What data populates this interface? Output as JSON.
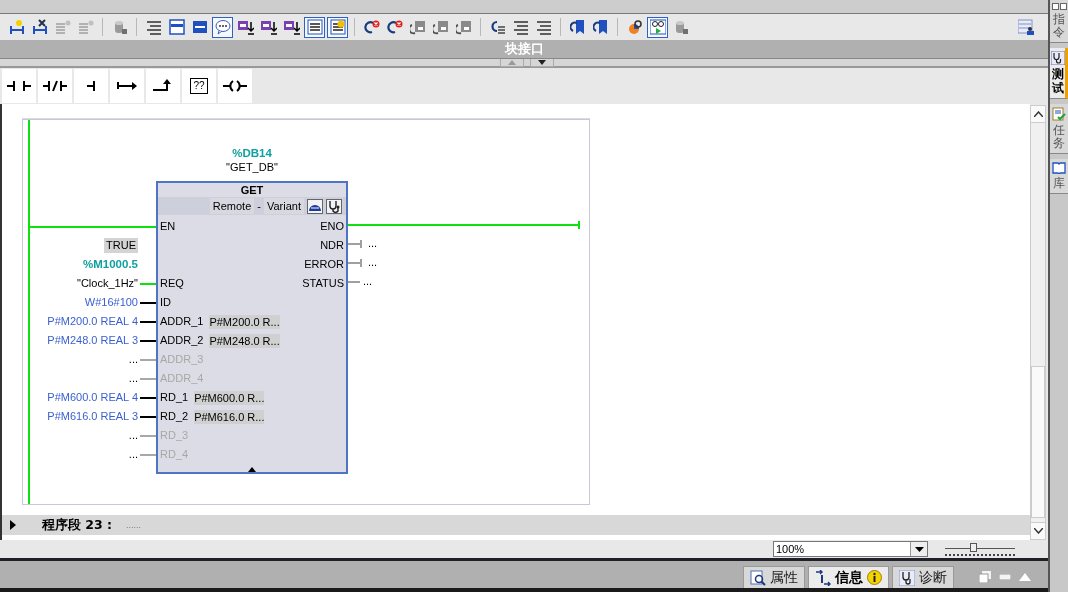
{
  "toolbar_groups": [
    {
      "buttons": [
        {
          "kind": "network-add",
          "on": false
        },
        {
          "kind": "network-delete",
          "on": false
        },
        {
          "kind": "gray-lines",
          "on": false
        },
        {
          "kind": "gray-lines",
          "on": false
        }
      ]
    },
    {
      "buttons": [
        {
          "kind": "cylinder",
          "on": false
        }
      ]
    },
    {
      "buttons": [
        {
          "kind": "lines",
          "on": false
        },
        {
          "kind": "panel",
          "on": false
        },
        {
          "kind": "panel-solid",
          "on": false
        },
        {
          "kind": "bubble",
          "on": true
        },
        {
          "kind": "tag-down",
          "on": false
        },
        {
          "kind": "tag-down",
          "on": false
        },
        {
          "kind": "tag-down",
          "on": false
        },
        {
          "kind": "list",
          "on": true
        },
        {
          "kind": "star-list",
          "on": true
        }
      ]
    },
    {
      "buttons": [
        {
          "kind": "arrow-cross",
          "on": false
        },
        {
          "kind": "arrow-cross",
          "on": false
        },
        {
          "kind": "box-arrow",
          "on": false
        },
        {
          "kind": "box-arrow",
          "on": false
        },
        {
          "kind": "box-arrow",
          "on": false
        }
      ]
    },
    {
      "buttons": [
        {
          "kind": "arrow-lines",
          "on": false
        },
        {
          "kind": "lines",
          "on": false
        },
        {
          "kind": "lines",
          "on": false
        }
      ]
    },
    {
      "buttons": [
        {
          "kind": "bookmark-arrow",
          "on": false
        },
        {
          "kind": "bookmark-arrow",
          "on": false
        }
      ]
    },
    {
      "buttons": [
        {
          "kind": "magnifier",
          "on": false
        },
        {
          "kind": "glasses",
          "on": true
        },
        {
          "kind": "cylinder",
          "on": false
        }
      ]
    }
  ],
  "interface_bar": {
    "title": "块接口"
  },
  "instructions": [
    {
      "kind": "no-contact"
    },
    {
      "kind": "nc-contact"
    },
    {
      "kind": "branch-open"
    },
    {
      "kind": "jump"
    },
    {
      "kind": "branch-close"
    },
    {
      "kind": "empty-box",
      "label": "??"
    },
    {
      "kind": "coil"
    }
  ],
  "network": {
    "powered": true,
    "block": {
      "instance_address": "%DB14",
      "instance_name": "\"GET_DB\"",
      "type": "GET",
      "variant": [
        "Remote",
        "-",
        "Variant"
      ]
    },
    "inputs": [
      {
        "pin": "EN",
        "kind": "rail",
        "powered": true,
        "disabled": false
      },
      {
        "pin": "REQ",
        "kind": "tag",
        "value": "TRUE",
        "address": "%M1000.5",
        "operand": "\"Clock_1Hz\"",
        "powered": true,
        "disabled": false
      },
      {
        "pin": "ID",
        "kind": "constant",
        "operand": "W#16#100",
        "powered": false,
        "disabled": false
      },
      {
        "pin": "ADDR_1",
        "kind": "constant",
        "operand": "P#M200.0 REAL 4",
        "hint": "P#M200.0 R...",
        "powered": false,
        "disabled": false
      },
      {
        "pin": "ADDR_2",
        "kind": "constant",
        "operand": "P#M248.0 REAL 3",
        "hint": "P#M248.0 R...",
        "powered": false,
        "disabled": false
      },
      {
        "pin": "ADDR_3",
        "kind": "empty",
        "operand": "...",
        "powered": false,
        "disabled": true
      },
      {
        "pin": "ADDR_4",
        "kind": "empty",
        "operand": "...",
        "powered": false,
        "disabled": true
      },
      {
        "pin": "RD_1",
        "kind": "constant",
        "operand": "P#M600.0 REAL 4",
        "hint": "P#M600.0 R...",
        "powered": false,
        "disabled": false
      },
      {
        "pin": "RD_2",
        "kind": "constant",
        "operand": "P#M616.0 REAL 3",
        "hint": "P#M616.0 R...",
        "powered": false,
        "disabled": false
      },
      {
        "pin": "RD_3",
        "kind": "empty",
        "operand": "...",
        "powered": false,
        "disabled": true
      },
      {
        "pin": "RD_4",
        "kind": "empty",
        "operand": "...",
        "powered": false,
        "disabled": true
      }
    ],
    "outputs": [
      {
        "pin": "ENO",
        "kind": "rail",
        "powered": true
      },
      {
        "pin": "NDR",
        "kind": "bool",
        "operand": "...",
        "powered": false
      },
      {
        "pin": "ERROR",
        "kind": "bool",
        "operand": "...",
        "powered": false
      },
      {
        "pin": "STATUS",
        "kind": "word",
        "operand": "...",
        "powered": false
      }
    ]
  },
  "next_network": {
    "title": "程序段 23 :",
    "comment": "......",
    "expanded": false
  },
  "zoom": {
    "value": "100%",
    "level": 0.4
  },
  "bottom_tabs": [
    {
      "label": "属性",
      "kind": "properties",
      "selected": false
    },
    {
      "label": "信息",
      "kind": "info",
      "selected": true
    },
    {
      "label": "诊断",
      "kind": "diagnostics",
      "selected": false
    }
  ],
  "side_tabs": [
    {
      "label": "指令",
      "kind": "instructions",
      "selected": false
    },
    {
      "label": "测试",
      "kind": "testing",
      "selected": true
    },
    {
      "label": "任务",
      "kind": "tasks",
      "selected": false
    },
    {
      "label": "库",
      "kind": "libraries",
      "selected": false
    }
  ]
}
